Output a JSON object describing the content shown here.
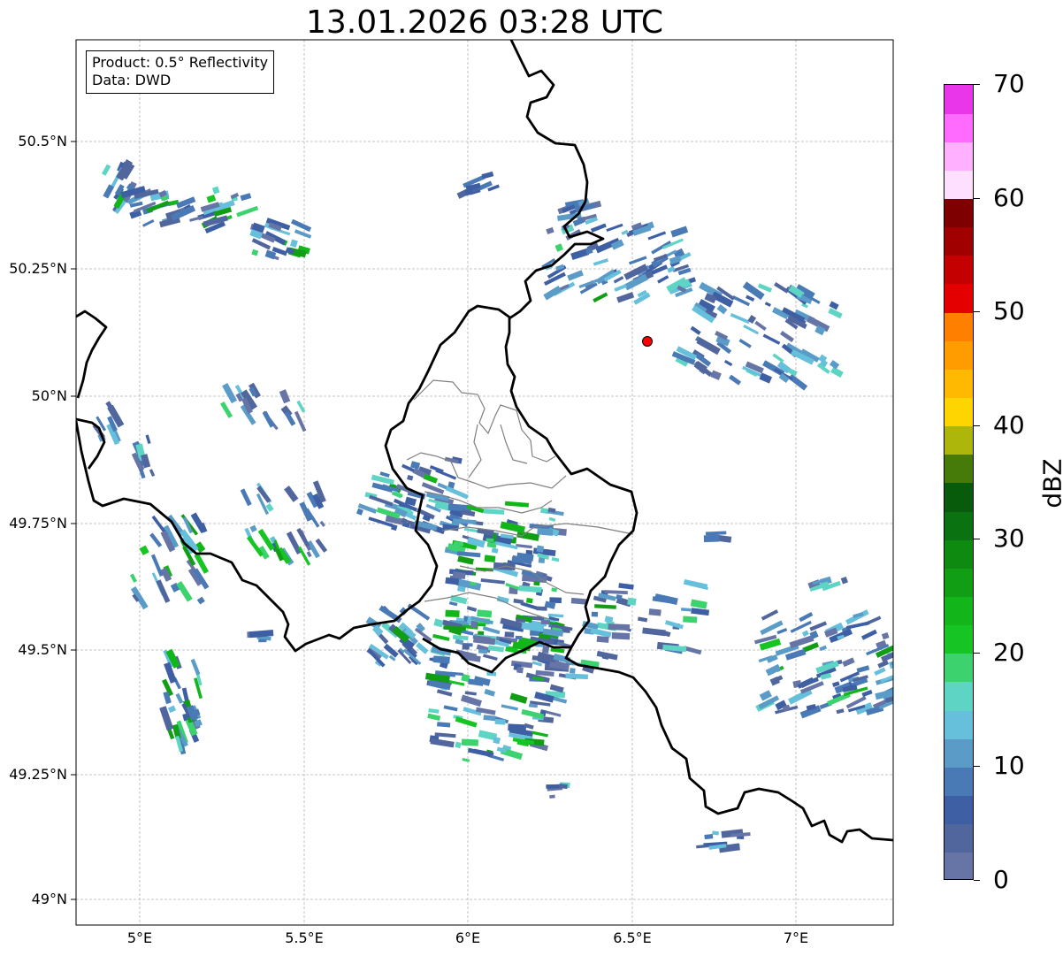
{
  "title": "13.01.2026 03:28 UTC",
  "legend": {
    "line1": "Product: 0.5° Reflectivity",
    "line2": "Data: DWD"
  },
  "axes": {
    "lat_labels": [
      "50.5°N",
      "50.25°N",
      "50°N",
      "49.75°N",
      "49.5°N",
      "49.25°N",
      "49°N"
    ],
    "lon_labels": [
      "5°E",
      "5.5°E",
      "6°E",
      "6.5°E",
      "7°E"
    ]
  },
  "colorbar": {
    "label": "dBZ",
    "ticks": [
      "0",
      "10",
      "20",
      "30",
      "40",
      "50",
      "60",
      "70"
    ],
    "colors": [
      "#6675a6",
      "#52669e",
      "#3f5fa4",
      "#4a7ab6",
      "#5a9bc8",
      "#66c0dc",
      "#5ed4c4",
      "#3cd36e",
      "#16c423",
      "#12b51a",
      "#119e14",
      "#0f8a10",
      "#0b7211",
      "#075b0a",
      "#467b0a",
      "#adb60a",
      "#ffd500",
      "#ffb900",
      "#ff9c00",
      "#ff7f00",
      "#e40000",
      "#c50000",
      "#a00000",
      "#7e0000",
      "#ffdfff",
      "#ffb1ff",
      "#ff6aff",
      "#ea36ea"
    ]
  },
  "station": {
    "name": "radar-site",
    "color": "#ff0000"
  },
  "map_colors": {
    "border": "#000000",
    "admin": "#808080",
    "grid": "#b4b4b4"
  }
}
